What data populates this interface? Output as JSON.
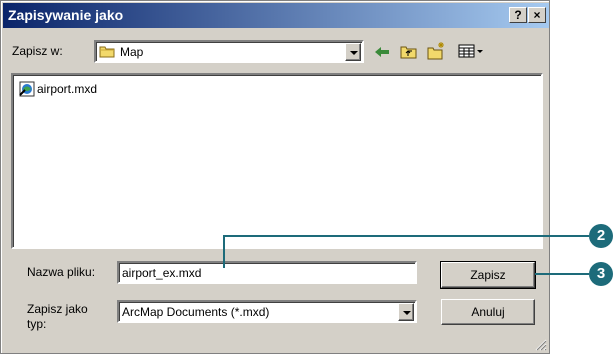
{
  "dialog": {
    "title": "Zapisywanie jako",
    "help_button": "?",
    "close_button": "×"
  },
  "toolbar": {
    "save_in_label": "Zapisz w:",
    "save_in_value": "Map"
  },
  "file_list": {
    "items": [
      {
        "name": "airport.mxd",
        "icon": "arcmap-document-icon"
      }
    ]
  },
  "form": {
    "filename_label": "Nazwa pliku:",
    "filename_value": "airport_ex.mxd",
    "filetype_label_line1": "Zapisz jako",
    "filetype_label_line2": "typ:",
    "filetype_value": "ArcMap Documents (*.mxd)",
    "save_button": "Zapisz",
    "cancel_button": "Anuluj"
  },
  "callouts": {
    "step_filename": "2",
    "step_save": "3"
  },
  "colors": {
    "titlebar_start": "#0a246a",
    "titlebar_end": "#a6caf0",
    "callout": "#1d6b7a"
  }
}
